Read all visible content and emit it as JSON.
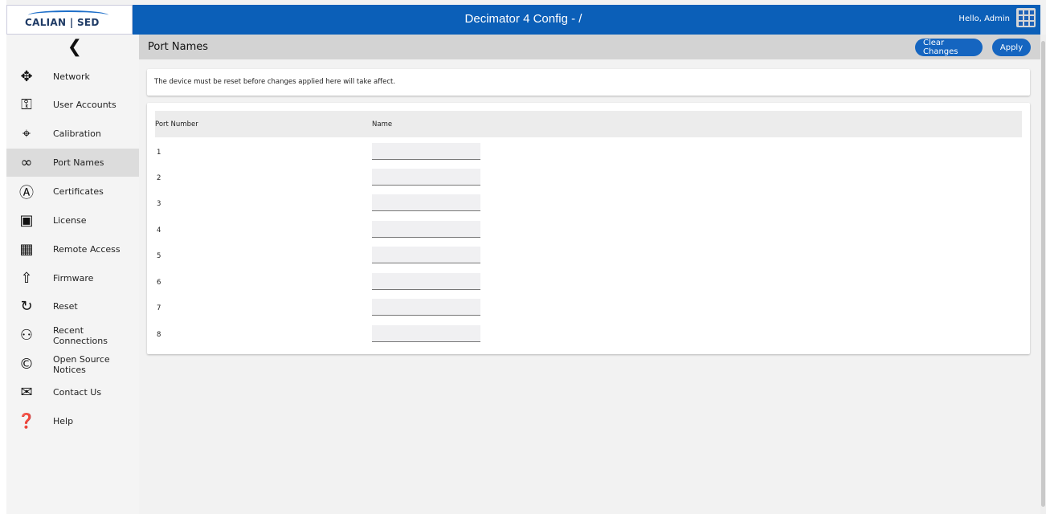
{
  "topbar": {
    "logo_text": "CALIAN | SED",
    "app_title": "Decimator 4 Config - /",
    "greeting": "Hello, Admin",
    "apps_icon": "grid-icon"
  },
  "sidebar": {
    "back_icon": "chevron-left-icon",
    "items": [
      {
        "label": "Network",
        "icon": "network-icon"
      },
      {
        "label": "User Accounts",
        "icon": "key-icon"
      },
      {
        "label": "Calibration",
        "icon": "crosshair-icon"
      },
      {
        "label": "Port Names",
        "icon": "cable-icon",
        "active": true
      },
      {
        "label": "Certificates",
        "icon": "certificate-lock-icon"
      },
      {
        "label": "License",
        "icon": "license-icon"
      },
      {
        "label": "Remote Access",
        "icon": "remote-monitor-icon"
      },
      {
        "label": "Firmware",
        "icon": "upload-icon"
      },
      {
        "label": "Reset",
        "icon": "reset-icon"
      },
      {
        "label": "Recent Connections",
        "icon": "users-icon"
      },
      {
        "label": "Open Source Notices",
        "icon": "copyright-icon"
      },
      {
        "label": "Contact Us",
        "icon": "contact-icon"
      },
      {
        "label": "Help",
        "icon": "help-icon"
      }
    ]
  },
  "header": {
    "title": "Port Names",
    "clear_label": "Clear Changes",
    "apply_label": "Apply"
  },
  "notice": "The device must be reset before changes applied here will take affect.",
  "table": {
    "col_port": "Port Number",
    "col_name": "Name",
    "rows": [
      {
        "port": "1",
        "name": ""
      },
      {
        "port": "2",
        "name": ""
      },
      {
        "port": "3",
        "name": ""
      },
      {
        "port": "4",
        "name": ""
      },
      {
        "port": "5",
        "name": ""
      },
      {
        "port": "6",
        "name": ""
      },
      {
        "port": "7",
        "name": ""
      },
      {
        "port": "8",
        "name": ""
      }
    ]
  }
}
